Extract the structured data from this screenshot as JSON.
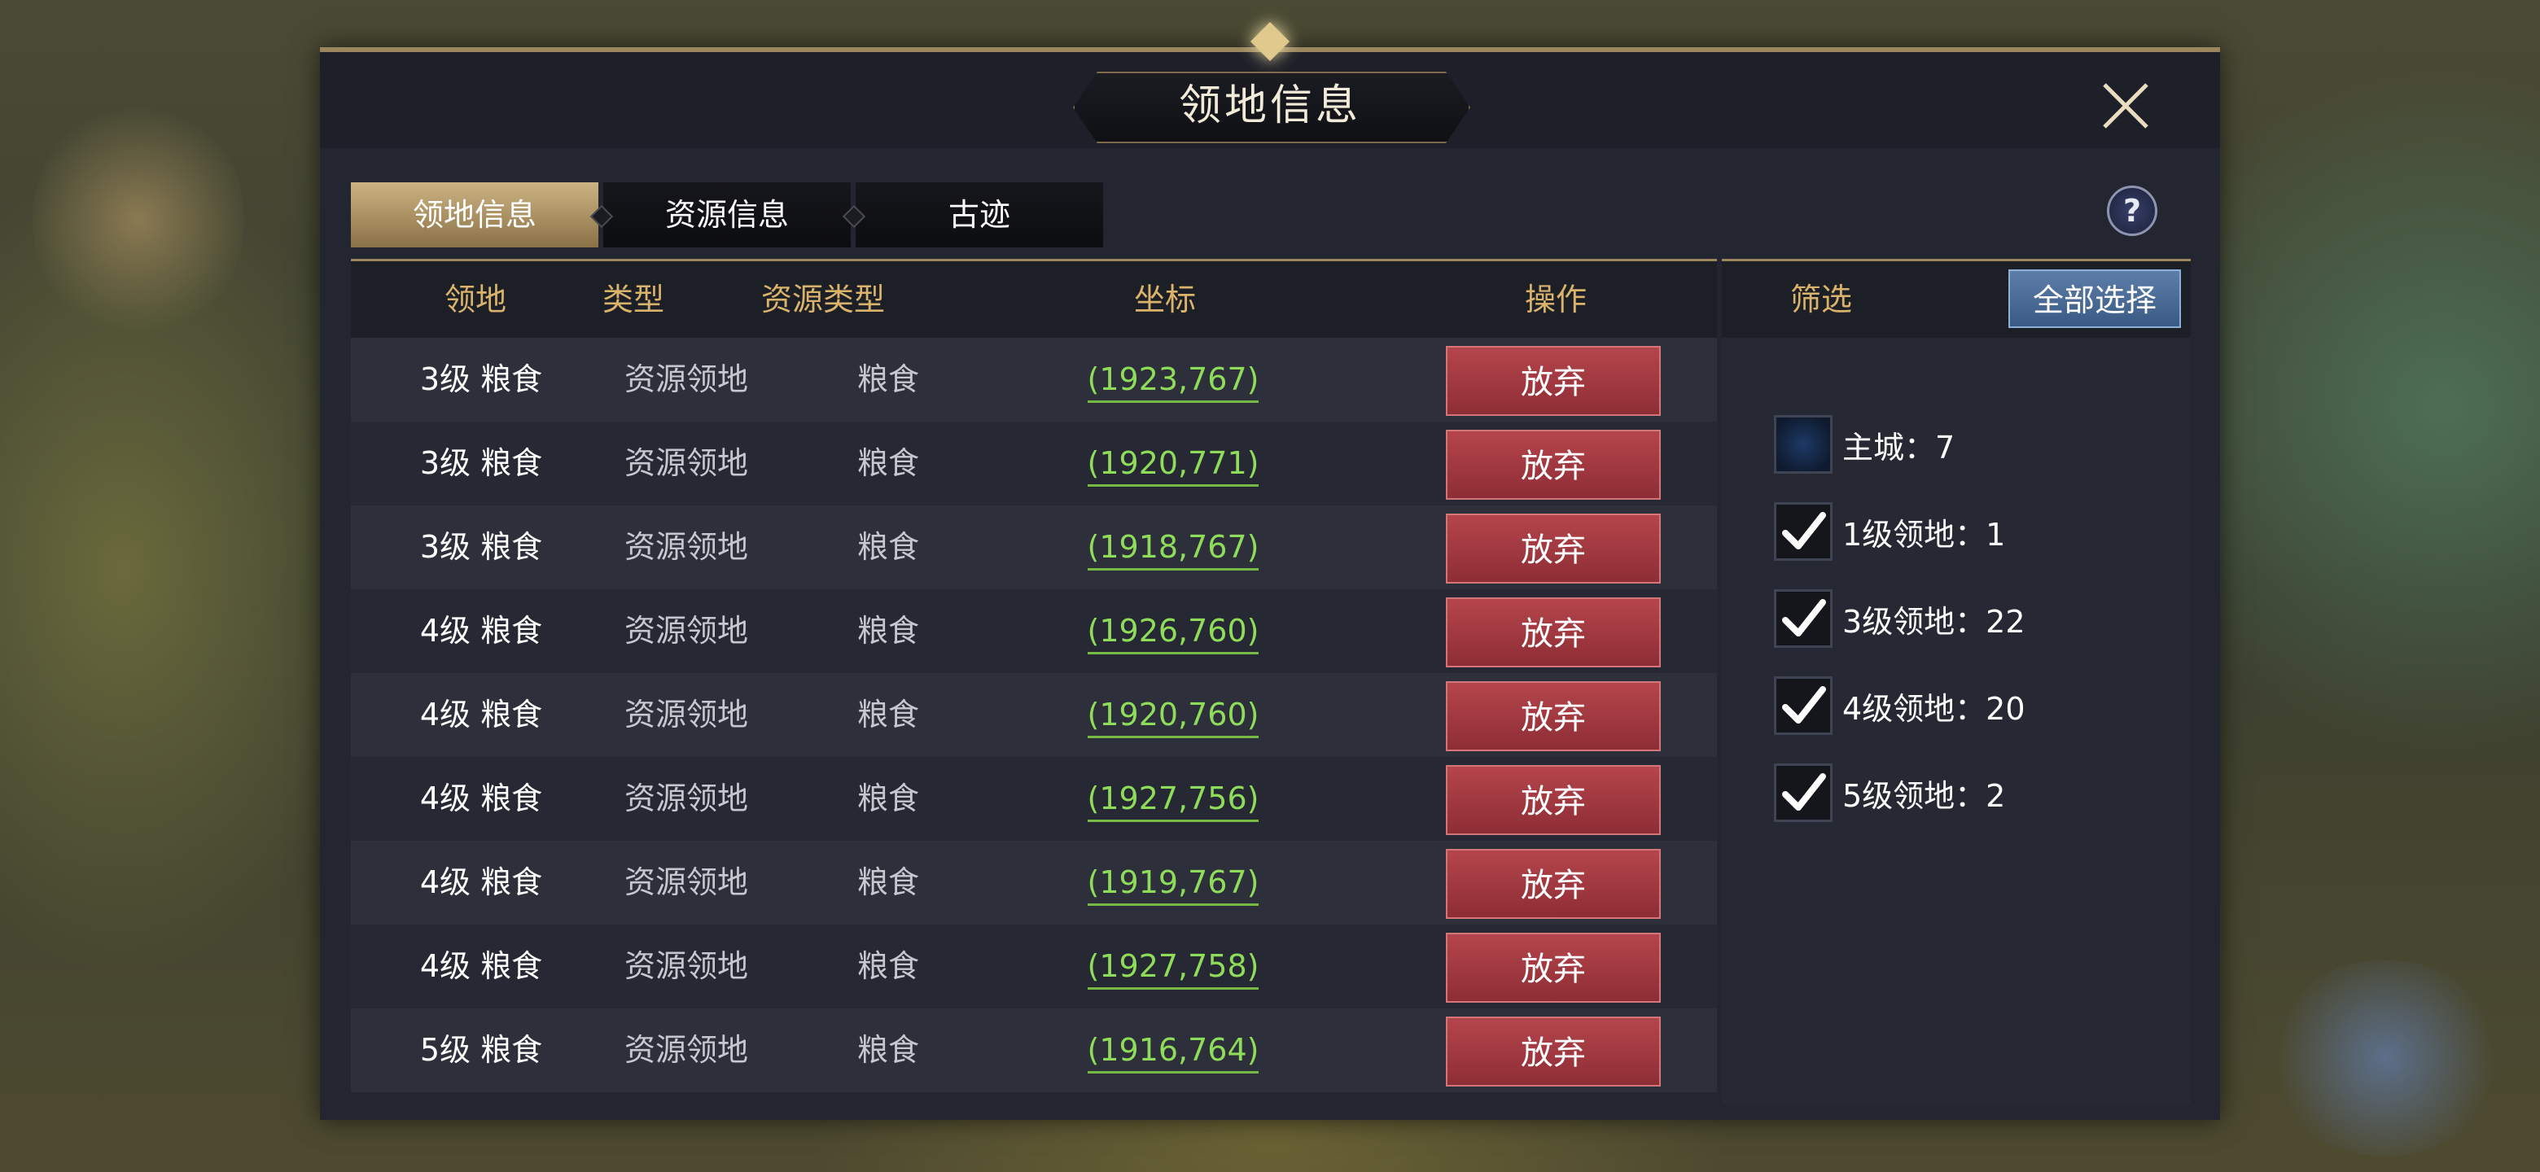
{
  "dialog": {
    "title": "领地信息",
    "tabs": [
      {
        "label": "领地信息",
        "active": true
      },
      {
        "label": "资源信息",
        "active": false
      },
      {
        "label": "古迹",
        "active": false
      }
    ]
  },
  "table": {
    "headers": [
      "领地",
      "类型",
      "资源类型",
      "坐标",
      "操作"
    ],
    "rows": [
      {
        "territory": "3级  粮食",
        "type": "资源领地",
        "resource": "粮食",
        "coord": "(1923,767)",
        "action": "放弃"
      },
      {
        "territory": "3级  粮食",
        "type": "资源领地",
        "resource": "粮食",
        "coord": "(1920,771)",
        "action": "放弃"
      },
      {
        "territory": "3级  粮食",
        "type": "资源领地",
        "resource": "粮食",
        "coord": "(1918,767)",
        "action": "放弃"
      },
      {
        "territory": "4级  粮食",
        "type": "资源领地",
        "resource": "粮食",
        "coord": "(1926,760)",
        "action": "放弃"
      },
      {
        "territory": "4级  粮食",
        "type": "资源领地",
        "resource": "粮食",
        "coord": "(1920,760)",
        "action": "放弃"
      },
      {
        "territory": "4级  粮食",
        "type": "资源领地",
        "resource": "粮食",
        "coord": "(1927,756)",
        "action": "放弃"
      },
      {
        "territory": "4级  粮食",
        "type": "资源领地",
        "resource": "粮食",
        "coord": "(1919,767)",
        "action": "放弃"
      },
      {
        "territory": "4级  粮食",
        "type": "资源领地",
        "resource": "粮食",
        "coord": "(1927,758)",
        "action": "放弃"
      },
      {
        "territory": "5级  粮食",
        "type": "资源领地",
        "resource": "粮食",
        "coord": "(1916,764)",
        "action": "放弃"
      }
    ]
  },
  "filter": {
    "label": "筛选",
    "select_all": "全部选择",
    "items": [
      {
        "label": "主城：7",
        "checked": false
      },
      {
        "label": "1级领地：1",
        "checked": true
      },
      {
        "label": "3级领地：22",
        "checked": true
      },
      {
        "label": "4级领地：20",
        "checked": true
      },
      {
        "label": "5级领地：2",
        "checked": true
      }
    ]
  },
  "icons": {
    "close": "close-icon",
    "help": "help-icon",
    "check": "checkmark-icon"
  },
  "colors": {
    "accent_gold": "#d9b26c",
    "abandon_red": "#a83a42",
    "coord_green": "#8fdc5a",
    "select_blue": "#4b6d98"
  }
}
